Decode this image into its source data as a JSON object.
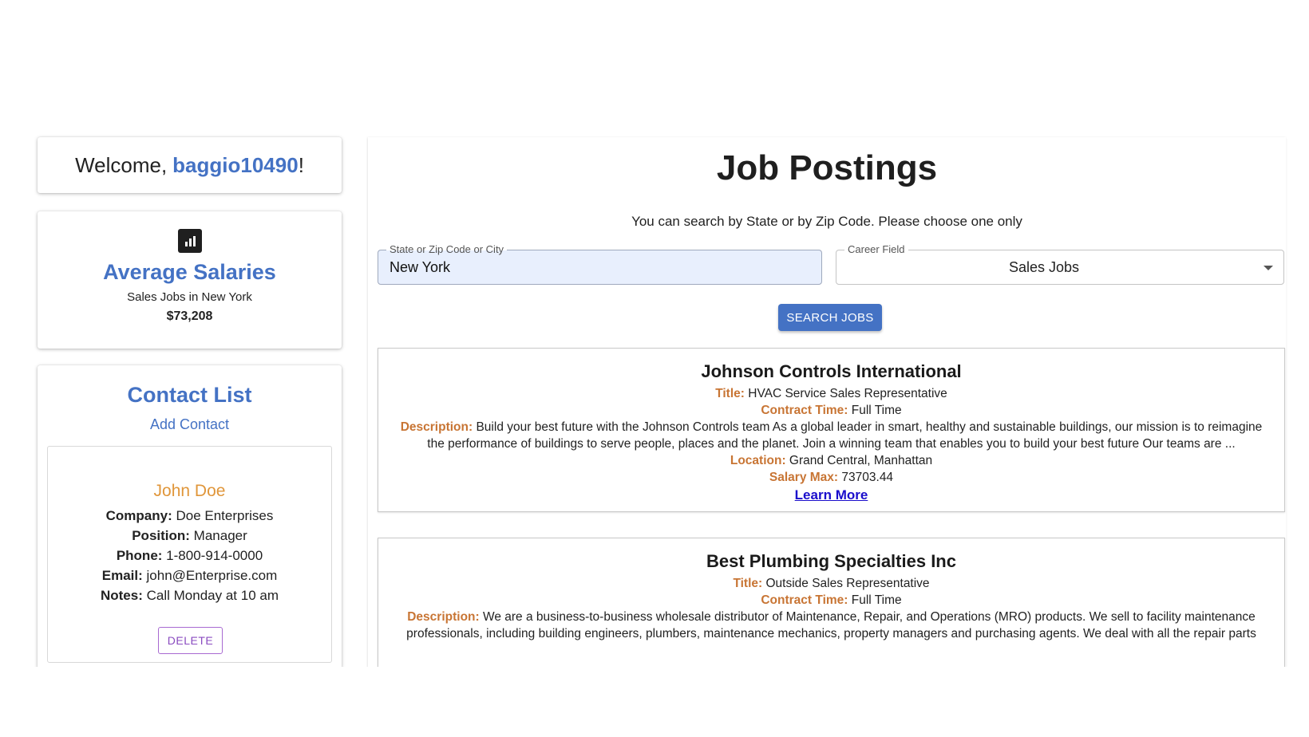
{
  "welcome": {
    "prefix": "Welcome,",
    "username": "baggio10490",
    "suffix": "!"
  },
  "salary": {
    "icon": "bar-chart-icon",
    "title": "Average Salaries",
    "subtitle": "Sales Jobs in New York",
    "value": "$73,208"
  },
  "contacts": {
    "title": "Contact List",
    "add_label": "Add Contact",
    "items": [
      {
        "name": "John Doe",
        "company_label": "Company:",
        "company": "Doe Enterprises",
        "position_label": "Position:",
        "position": "Manager",
        "phone_label": "Phone:",
        "phone": "1-800-914-0000",
        "email_label": "Email:",
        "email": "john@Enterprise.com",
        "notes_label": "Notes:",
        "notes": "Call Monday at 10 am",
        "delete_label": "DELETE"
      }
    ]
  },
  "main": {
    "title": "Job Postings",
    "hint": "You can search by State or by Zip Code. Please choose one only",
    "location_field": {
      "label": "State or Zip Code or City",
      "value": "New York"
    },
    "career_field": {
      "label": "Career Field",
      "value": "Sales Jobs"
    },
    "search_button": "SEARCH JOBS"
  },
  "jobs": [
    {
      "company": "Johnson Controls International",
      "title_label": "Title:",
      "title": "HVAC Service Sales Representative",
      "contract_label": "Contract Time:",
      "contract": "Full Time",
      "description_label": "Description:",
      "description_line1": "Build your best future with the Johnson Controls team As a global leader in smart, healthy and sustainable buildings, our mission is to reimagine",
      "description_line2": "the performance of buildings to serve people, places and the planet. Join a winning team that enables you to build your best future Our teams are ...",
      "location_label": "Location:",
      "location": "Grand Central, Manhattan",
      "salary_label": "Salary Max:",
      "salary": "73703.44",
      "learn_more": "Learn More"
    },
    {
      "company": "Best Plumbing Specialties Inc",
      "title_label": "Title:",
      "title": "Outside Sales Representative",
      "contract_label": "Contract Time:",
      "contract": "Full Time",
      "description_label": "Description:",
      "description_line1": "We are a business-to-business wholesale distributor of Maintenance, Repair, and Operations (MRO) products. We sell to facility maintenance",
      "description_line2": "professionals, including building engineers, plumbers, maintenance mechanics, property managers and purchasing agents. We deal with all the repair parts"
    }
  ],
  "colors": {
    "accent": "#4472c4",
    "contact_name": "#e0963a",
    "label": "#c87534",
    "delete": "#8a4bc0",
    "link": "#1a0dcc"
  }
}
